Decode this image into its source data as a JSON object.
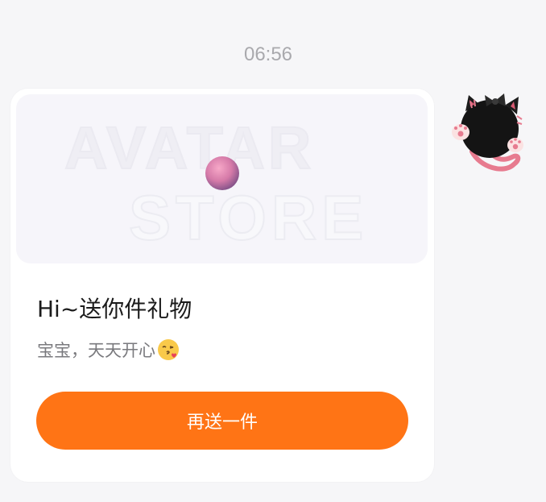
{
  "chat": {
    "timestamp": "06:56"
  },
  "gift_card": {
    "banner_text_line1": "AVATAR",
    "banner_text_line2": "STORE",
    "title": "Hi~送你件礼物",
    "subtitle": "宝宝，天天开心",
    "emoji": "kissing-face-with-heart",
    "button_label": "再送一件"
  },
  "colors": {
    "accent": "#ff7415",
    "background": "#f6f6f8",
    "card": "#ffffff",
    "timestamp": "#a9a9ad"
  },
  "avatar": {
    "icon": "black-cat-avatar-icon"
  }
}
